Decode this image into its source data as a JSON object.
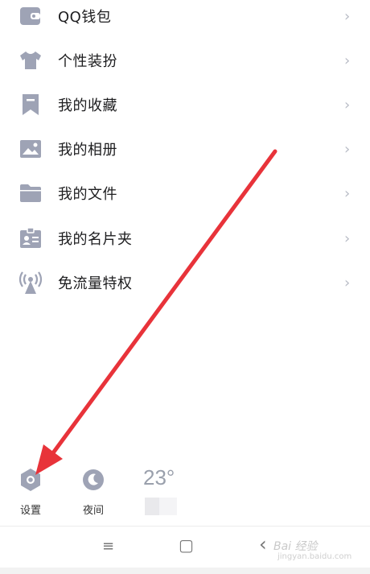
{
  "menu": {
    "items": [
      {
        "label": "QQ钱包",
        "icon": "wallet-icon"
      },
      {
        "label": "个性装扮",
        "icon": "tshirt-icon"
      },
      {
        "label": "我的收藏",
        "icon": "bookmark-icon"
      },
      {
        "label": "我的相册",
        "icon": "photo-album-icon"
      },
      {
        "label": "我的文件",
        "icon": "folder-icon"
      },
      {
        "label": "我的名片夹",
        "icon": "business-card-icon"
      },
      {
        "label": "免流量特权",
        "icon": "signal-tower-icon"
      }
    ],
    "chevron": "›"
  },
  "bottom": {
    "settings_label": "设置",
    "night_label": "夜间",
    "temperature": "23°"
  },
  "navbar": {
    "menu_glyph": "≡",
    "home_glyph": "▢",
    "back_glyph": "‹"
  },
  "watermark": {
    "text": "Bai 经验",
    "sub": "jingyan.baidu.com"
  },
  "colors": {
    "icon": "#9ea3b5",
    "arrow": "#e8333a"
  }
}
